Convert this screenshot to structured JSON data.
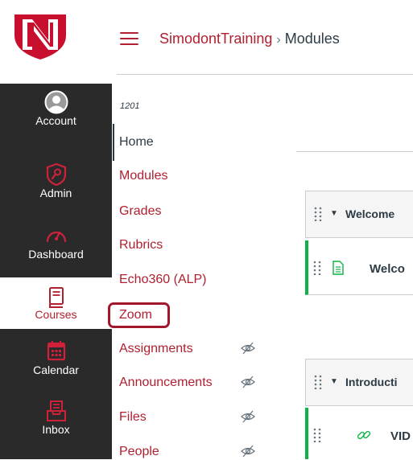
{
  "colors": {
    "brand": "#b02030",
    "nav_background": "#2a2a2a",
    "published_green": "#0cb543",
    "text": "#2d3b45"
  },
  "global_nav": {
    "items": [
      {
        "label": "Account",
        "icon": "user-avatar-icon"
      },
      {
        "label": "Admin",
        "icon": "shield-icon"
      },
      {
        "label": "Dashboard",
        "icon": "speedometer-icon"
      },
      {
        "label": "Courses",
        "icon": "book-icon",
        "active": true
      },
      {
        "label": "Calendar",
        "icon": "calendar-icon"
      },
      {
        "label": "Inbox",
        "icon": "inbox-icon"
      }
    ]
  },
  "header": {
    "breadcrumb": {
      "course": "SimodontTraining",
      "separator": "›",
      "current": "Modules"
    }
  },
  "course_nav": {
    "term": "1201",
    "items": [
      {
        "label": "Home",
        "active": true
      },
      {
        "label": "Modules"
      },
      {
        "label": "Grades"
      },
      {
        "label": "Rubrics"
      },
      {
        "label": "Echo360 (ALP)"
      },
      {
        "label": "Zoom",
        "highlighted": true
      },
      {
        "label": "Assignments",
        "hidden": true
      },
      {
        "label": "Announcements",
        "hidden": true
      },
      {
        "label": "Files",
        "hidden": true
      },
      {
        "label": "People",
        "hidden": true
      }
    ]
  },
  "modules": [
    {
      "title": "Welcome",
      "items": [
        {
          "title": "Welco",
          "icon": "page-icon"
        }
      ]
    },
    {
      "title": "Introducti",
      "items": [
        {
          "title": "VID",
          "icon": "link-icon"
        }
      ]
    }
  ]
}
